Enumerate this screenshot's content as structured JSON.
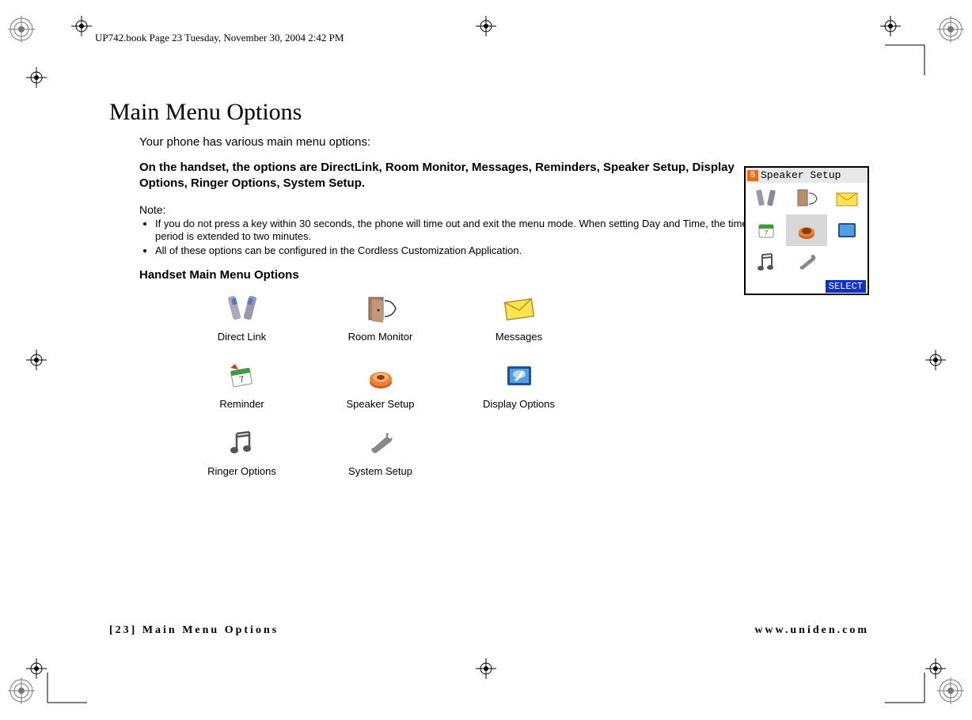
{
  "header_line": "UP742.book  Page 23  Tuesday, November 30, 2004  2:42 PM",
  "title": "Main Menu Options",
  "intro": "Your phone has various main menu options:",
  "bold_para": "On the handset, the options are DirectLink, Room Monitor, Messages, Reminders, Speaker Setup, Display Options, Ringer Options, System Setup.",
  "note_label": "Note:",
  "notes": [
    "If you do not press a key within 30 seconds, the phone will time out and exit the menu mode. When setting Day and Time, the time-out period is extended to two minutes.",
    "All of these options can be configured in the Cordless Customization Application."
  ],
  "subhead": "Handset Main Menu Options",
  "icons": {
    "r1c1": "Direct Link",
    "r1c2": "Room Monitor",
    "r1c3": "Messages",
    "r2c1": "Reminder",
    "r2c2": "Speaker Setup",
    "r2c3": "Display Options",
    "r3c1": "Ringer Options",
    "r3c2": "System Setup"
  },
  "footer": {
    "left": "[23] Main Menu Options",
    "right": "www.uniden.com"
  },
  "screenshot": {
    "num": "5",
    "title": "Speaker Setup",
    "select": "SELECT"
  }
}
